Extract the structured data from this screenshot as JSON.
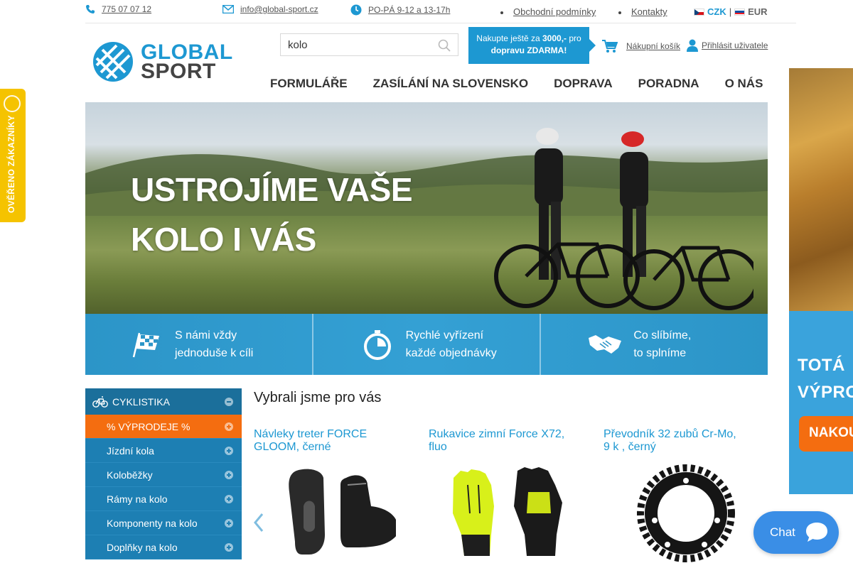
{
  "topbar": {
    "phone": "775 07 07 12",
    "email": "info@global-sport.cz",
    "hours": "PO-PÁ 9-12 a 13-17h",
    "links": [
      "Obchodní podmínky",
      "Kontakty"
    ],
    "currency": {
      "czk": "CZK",
      "separator": "|",
      "eur": "EUR"
    }
  },
  "header": {
    "logo": {
      "line1": "GLOBAL",
      "line2": "SPORT"
    },
    "search": {
      "value": "kolo"
    },
    "promo": {
      "prefix": "Nakupte ještě za ",
      "amount": "3000,-",
      "suffix": " pro",
      "line2": "dopravu ZDARMA!"
    },
    "cart_label": "Nákupní košík",
    "login_label": "Přihlásit uživatele"
  },
  "nav": [
    "FORMULÁŘE",
    "ZASÍLÁNÍ NA SLOVENSKO",
    "DOPRAVA",
    "PORADNA",
    "O NÁS"
  ],
  "hero": {
    "line1": "USTROJÍME VAŠE",
    "line2": "KOLO I VÁS"
  },
  "features": [
    {
      "icon": "checkered-flag-icon",
      "line1": "S námi vždy",
      "line2": "jednoduše k cíli"
    },
    {
      "icon": "stopwatch-icon",
      "line1": "Rychlé vyřízení",
      "line2": "každé objednávky"
    },
    {
      "icon": "handshake-icon",
      "line1": "Co slíbíme,",
      "line2": "to splníme"
    }
  ],
  "sidebar": {
    "header": "CYKLISTIKA",
    "items": [
      "% VÝPRODEJE %",
      "Jízdní kola",
      "Koloběžky",
      "Rámy na kolo",
      "Komponenty na kolo",
      "Doplňky na kolo"
    ]
  },
  "picks": {
    "title": "Vybrali jsme pro vás",
    "products": [
      {
        "name": "Návleky treter FORCE GLOOM, černé"
      },
      {
        "name": "Rukavice zimní Force X72, fluo"
      },
      {
        "name": "Převodník 32 zubů Cr-Mo, 9 k , černý"
      }
    ]
  },
  "side_banner": {
    "line1": "TOTÁ",
    "line2": "VÝPRO",
    "button": "NAKOU"
  },
  "badge": {
    "text": "OVĚŘENO ZÁKAZNÍKY"
  },
  "chat": {
    "label": "Chat"
  },
  "colors": {
    "brand_blue": "#1d98d2",
    "sale_orange": "#f46d10",
    "sidebar_blue": "#1d7fb3",
    "badge_yellow": "#f5c300"
  }
}
